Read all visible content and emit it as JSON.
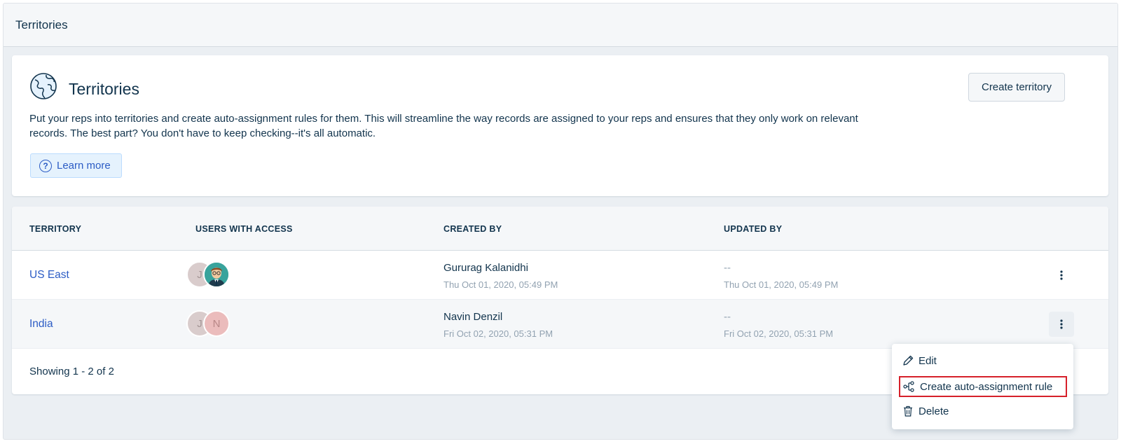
{
  "header": {
    "title": "Territories"
  },
  "info": {
    "title": "Territories",
    "description": "Put your reps into territories and create auto-assignment rules for them. This will streamline the way records are assigned to your reps and ensures that they only work on relevant records. The best part? You don't have to keep checking--it's all automatic.",
    "learn_more_label": "Learn more",
    "create_button_label": "Create territory"
  },
  "table": {
    "columns": [
      "TERRITORY",
      "USERS WITH ACCESS",
      "CREATED BY",
      "UPDATED BY"
    ],
    "rows": [
      {
        "territory": "US East",
        "users": [
          "J",
          "avatar-image"
        ],
        "created_by": "Gururag Kalanidhi",
        "created_at": "Thu Oct 01, 2020, 05:49 PM",
        "updated_by": "--",
        "updated_at": "Thu Oct 01, 2020, 05:49 PM"
      },
      {
        "territory": "India",
        "users": [
          "J",
          "N"
        ],
        "created_by": "Navin Denzil",
        "created_at": "Fri Oct 02, 2020, 05:31 PM",
        "updated_by": "--",
        "updated_at": "Fri Oct 02, 2020, 05:31 PM"
      }
    ],
    "pagination": "Showing 1 - 2 of 2"
  },
  "row_menu": {
    "items": [
      {
        "label": "Edit",
        "icon": "pencil-icon"
      },
      {
        "label": "Create auto-assignment rule",
        "icon": "workflow-icon",
        "highlighted": true
      },
      {
        "label": "Delete",
        "icon": "trash-icon"
      }
    ]
  },
  "colors": {
    "link": "#2c5cc5",
    "text": "#12344d",
    "highlight_border": "#d6202a",
    "muted": "#92a2b1"
  }
}
